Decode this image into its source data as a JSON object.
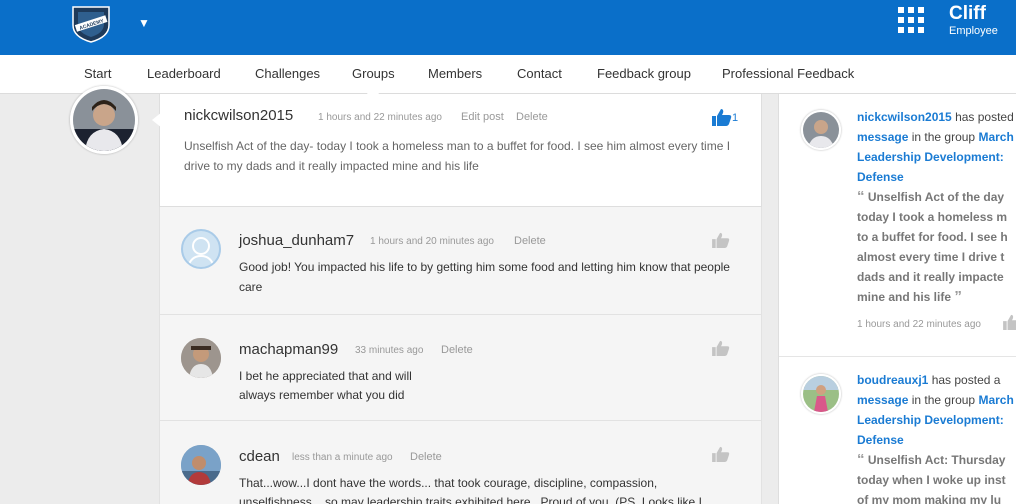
{
  "header": {
    "logo_text": "ACADEMY",
    "user_name": "Cliff",
    "user_role": "Employee"
  },
  "nav": {
    "items": [
      "Start",
      "Leaderboard",
      "Challenges",
      "Groups",
      "Members",
      "Contact",
      "Feedback group",
      "Professional Feedback"
    ]
  },
  "post": {
    "author": "nickcwilson2015",
    "time": "1 hours and 22 minutes ago",
    "edit_label": "Edit post",
    "delete_label": "Delete",
    "text": "Unselfish Act of the day- today I took a homeless man to a buffet for food. I see him almost every time I drive to my dads and it really impacted mine and his life",
    "likes": "1"
  },
  "comments": [
    {
      "author": "joshua_dunham7",
      "time": "1 hours and 20 minutes ago",
      "delete_label": "Delete",
      "text": "Good job! You impacted his life to by getting him some food and letting him know that people care"
    },
    {
      "author": "machapman99",
      "time": "33 minutes ago",
      "delete_label": "Delete",
      "text_line1": "I bet he appreciated that and will",
      "text_line2": "always remember what you did"
    },
    {
      "author": "cdean",
      "time": "less than a minute ago",
      "delete_label": "Delete",
      "text_line1": "That...wow...I dont have the words... that took courage, discipline, compassion,",
      "text_line2": "unselfishness... so may leadership traits exhibited here.. Proud of you. (PS. Looks like I"
    }
  ],
  "activity": [
    {
      "user": "nickcwilson2015",
      "action": "has posted a",
      "object": "message",
      "in_group": "in the group",
      "group_line1": "March",
      "group_line2": "Leadership Development:",
      "group_line3": "Defense",
      "quote_lines": [
        "Unselfish Act of the day",
        "today I took a homeless m",
        "to a buffet for food. I see h",
        "almost every time I drive t",
        "dads and it really impacte",
        "mine and his life"
      ],
      "time": "1 hours and 22 minutes ago"
    },
    {
      "user": "boudreauxj1",
      "action": "has posted a",
      "object": "message",
      "in_group": "in the group",
      "group_line1": "March",
      "group_line2": "Leadership Development:",
      "group_line3": "Defense",
      "quote_lines": [
        "Unselfish Act: Thursday",
        "today when I woke up inst",
        "of my mom making my lu"
      ]
    }
  ]
}
